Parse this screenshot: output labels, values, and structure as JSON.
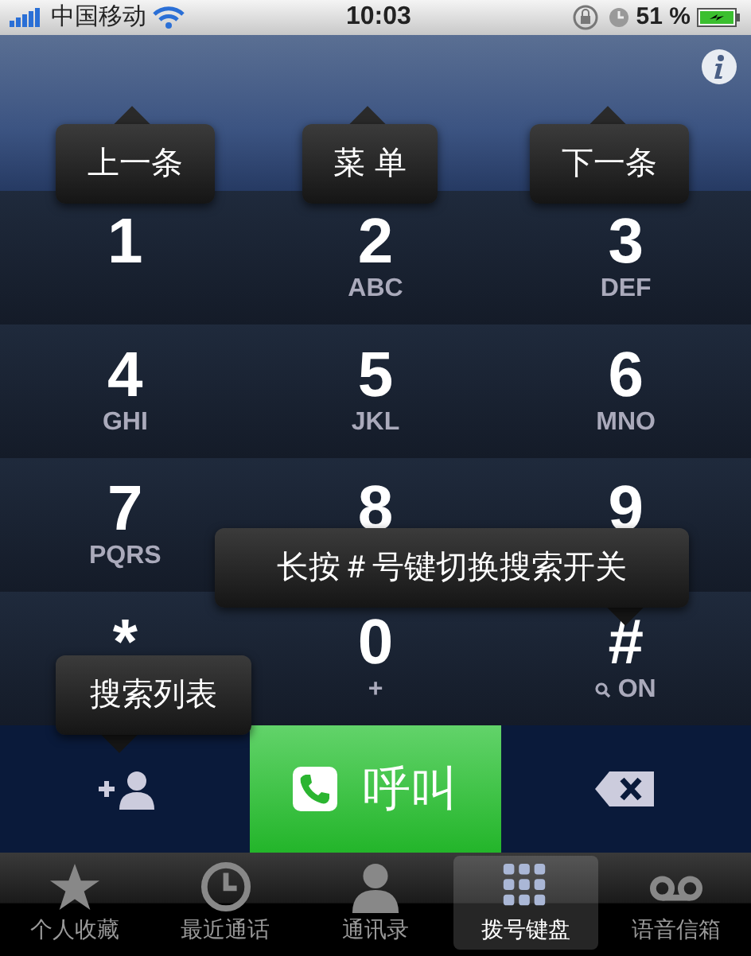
{
  "status_bar": {
    "carrier": "中国移动",
    "time": "10:03",
    "battery": "51 %"
  },
  "keys": [
    {
      "kind": "digit",
      "digit": "1"
    },
    {
      "kind": "digit",
      "digit": "2",
      "letters": "ABC"
    },
    {
      "kind": "digit",
      "digit": "3",
      "letters": "DEF"
    },
    {
      "kind": "digit",
      "digit": "4",
      "letters": "GHI"
    },
    {
      "kind": "digit",
      "digit": "5",
      "letters": "JKL"
    },
    {
      "kind": "digit",
      "digit": "6",
      "letters": "MNO"
    },
    {
      "kind": "digit",
      "digit": "7",
      "letters": "PQRS"
    },
    {
      "kind": "digit",
      "digit": "8"
    },
    {
      "kind": "digit",
      "digit": "9"
    },
    {
      "kind": "digit",
      "digit": "*"
    },
    {
      "kind": "digit",
      "digit": "0",
      "letters": "+"
    },
    {
      "kind": "search-toggle",
      "digit": "#",
      "letters": "ON"
    }
  ],
  "tooltips": [
    {
      "text": "上一条"
    },
    {
      "text": "菜 单"
    },
    {
      "text": "下一条"
    },
    {
      "text": "长按＃号键切换搜索开关"
    },
    {
      "text": "搜索列表"
    }
  ],
  "call_button": {
    "label": "呼叫"
  },
  "tabs": [
    {
      "label": "个人收藏",
      "selected": false
    },
    {
      "label": "最近通话",
      "selected": false
    },
    {
      "label": "通讯录",
      "selected": false
    },
    {
      "label": "拨号键盘",
      "selected": true
    },
    {
      "label": "语音信箱",
      "selected": false
    }
  ]
}
